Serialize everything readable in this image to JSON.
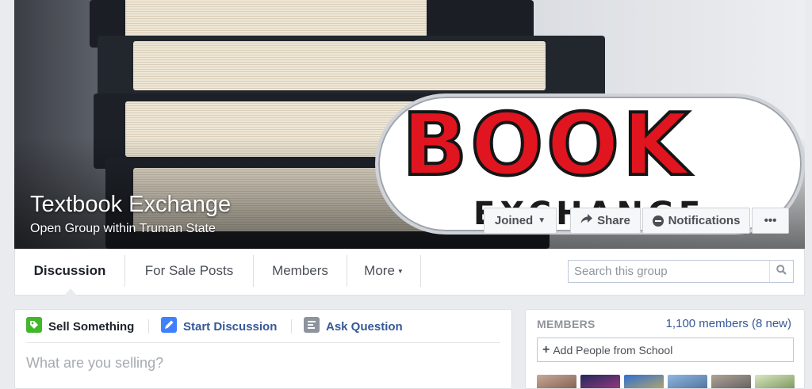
{
  "group": {
    "title": "Textbook Exchange",
    "subtitle": "Open Group within Truman State"
  },
  "cover": {
    "logo_word": "BOOK",
    "logo_subword": "EXCHANGE",
    "buttons": {
      "joined": "Joined",
      "share": "Share",
      "notifications": "Notifications",
      "more": "•••"
    }
  },
  "nav": {
    "tabs": [
      {
        "label": "Discussion",
        "active": true
      },
      {
        "label": "For Sale Posts"
      },
      {
        "label": "Members"
      },
      {
        "label": "More"
      }
    ],
    "search_placeholder": "Search this group"
  },
  "composer": {
    "tabs": [
      {
        "label": "Sell Something",
        "icon": "sell-tag-icon"
      },
      {
        "label": "Start Discussion",
        "icon": "pencil-icon"
      },
      {
        "label": "Ask Question",
        "icon": "question-icon"
      }
    ],
    "placeholder": "What are you selling?"
  },
  "members": {
    "heading": "MEMBERS",
    "count": "1,100 members (8 new)",
    "add_placeholder": "Add People from School",
    "thumb_colors": [
      "#8d6f63",
      "#5b3f7a",
      "#3f78c6",
      "#4f86b8",
      "#7a7f86",
      "#6f8a4a"
    ]
  },
  "colors": {
    "link": "#365899",
    "background": "#e9ebee",
    "logo_red": "#e0151f"
  }
}
